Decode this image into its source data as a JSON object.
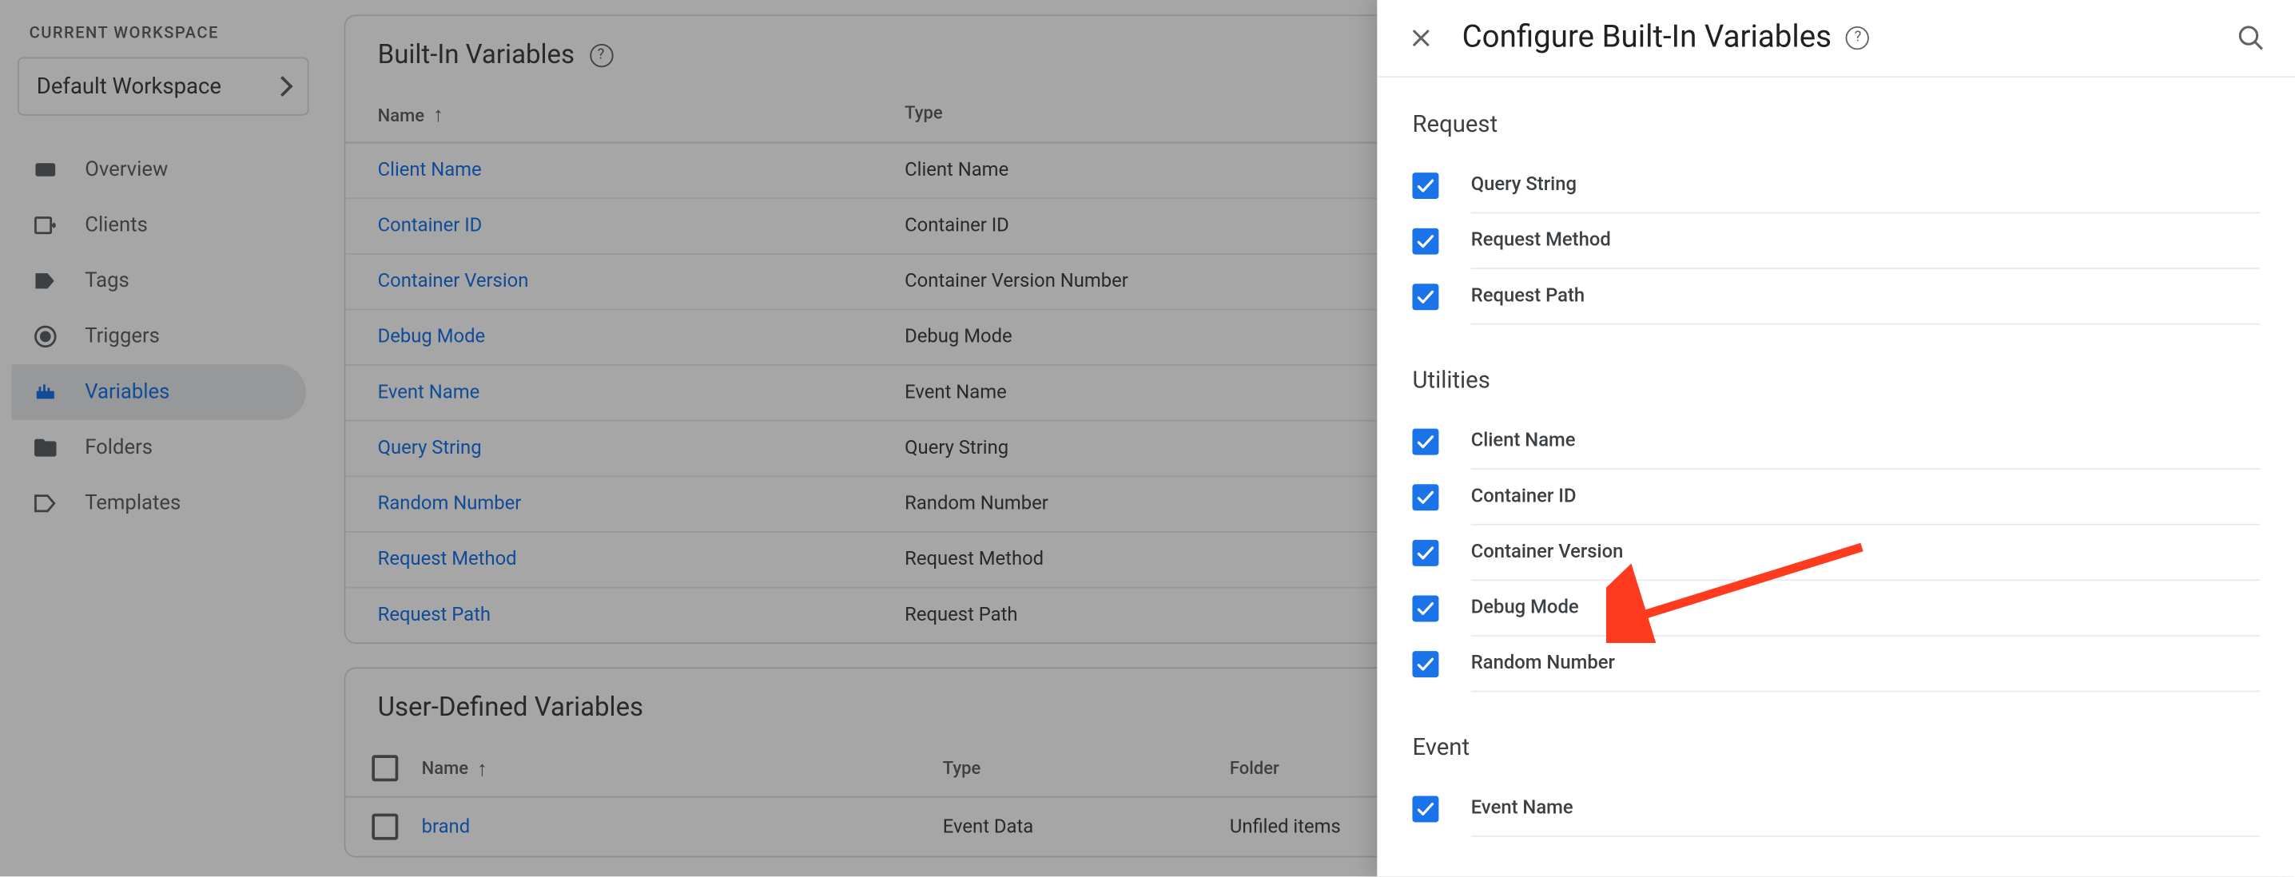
{
  "sidebar": {
    "workspace_label": "CURRENT WORKSPACE",
    "workspace_name": "Default Workspace",
    "nav": [
      {
        "label": "Overview",
        "icon": "overview"
      },
      {
        "label": "Clients",
        "icon": "clients"
      },
      {
        "label": "Tags",
        "icon": "tags"
      },
      {
        "label": "Triggers",
        "icon": "triggers"
      },
      {
        "label": "Variables",
        "icon": "variables",
        "active": true
      },
      {
        "label": "Folders",
        "icon": "folders"
      },
      {
        "label": "Templates",
        "icon": "templates"
      }
    ]
  },
  "builtin_card": {
    "title": "Built-In Variables",
    "columns": {
      "name": "Name",
      "type": "Type"
    },
    "rows": [
      {
        "name": "Client Name",
        "type": "Client Name"
      },
      {
        "name": "Container ID",
        "type": "Container ID"
      },
      {
        "name": "Container Version",
        "type": "Container Version Number"
      },
      {
        "name": "Debug Mode",
        "type": "Debug Mode"
      },
      {
        "name": "Event Name",
        "type": "Event Name"
      },
      {
        "name": "Query String",
        "type": "Query String"
      },
      {
        "name": "Random Number",
        "type": "Random Number"
      },
      {
        "name": "Request Method",
        "type": "Request Method"
      },
      {
        "name": "Request Path",
        "type": "Request Path"
      }
    ]
  },
  "udv_card": {
    "title": "User-Defined Variables",
    "columns": {
      "name": "Name",
      "type": "Type",
      "folder": "Folder"
    },
    "rows": [
      {
        "name": "brand",
        "type": "Event Data",
        "folder": "Unfiled items"
      }
    ]
  },
  "drawer": {
    "title": "Configure Built-In Variables",
    "sections": [
      {
        "title": "Request",
        "items": [
          {
            "label": "Query String",
            "checked": true
          },
          {
            "label": "Request Method",
            "checked": true
          },
          {
            "label": "Request Path",
            "checked": true
          }
        ]
      },
      {
        "title": "Utilities",
        "items": [
          {
            "label": "Client Name",
            "checked": true
          },
          {
            "label": "Container ID",
            "checked": true
          },
          {
            "label": "Container Version",
            "checked": true
          },
          {
            "label": "Debug Mode",
            "checked": true
          },
          {
            "label": "Random Number",
            "checked": true
          }
        ]
      },
      {
        "title": "Event",
        "items": [
          {
            "label": "Event Name",
            "checked": true
          }
        ]
      }
    ]
  }
}
